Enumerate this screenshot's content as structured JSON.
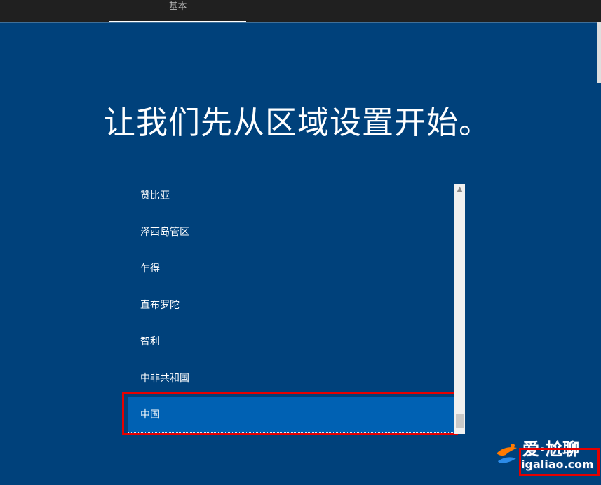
{
  "header": {
    "tab_label": "基本"
  },
  "main": {
    "title": "让我们先从区域设置开始。"
  },
  "regions": [
    "赞比亚",
    "泽西岛管区",
    "乍得",
    "直布罗陀",
    "智利",
    "中非共和国",
    "中国"
  ],
  "selected_region": "中国",
  "watermark": {
    "top_text": "爱·尬聊",
    "bottom_text": "igaliao.com"
  },
  "colors": {
    "background": "#00417b",
    "selection": "#0061b3",
    "highlight": "#e60000"
  }
}
